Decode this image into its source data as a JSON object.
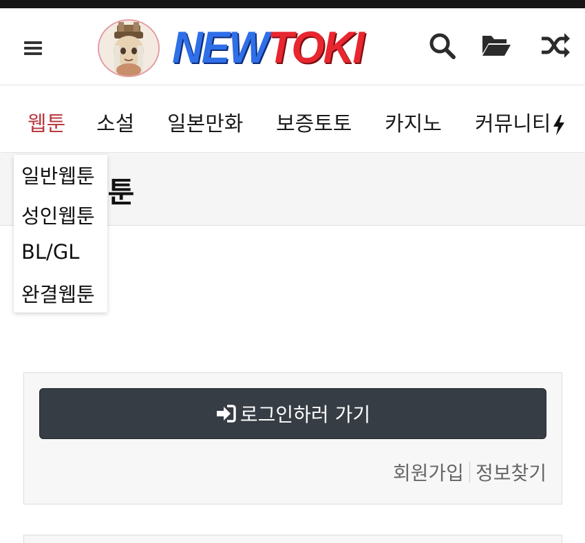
{
  "header": {
    "logo": {
      "part1": "NEW",
      "part2": "TOKI"
    },
    "icons": [
      "menu-icon",
      "search-icon",
      "folder-open-icon",
      "shuffle-icon"
    ]
  },
  "nav": {
    "items": [
      {
        "label": "웹툰",
        "active": true
      },
      {
        "label": "소설"
      },
      {
        "label": "일본만화"
      },
      {
        "label": "보증토토"
      },
      {
        "label": "카지노"
      },
      {
        "label": "커뮤니티"
      }
    ],
    "accent": "#b93a42"
  },
  "dropdown": {
    "items": [
      {
        "label": "일반웹툰"
      },
      {
        "label": "성인웹툰"
      },
      {
        "label": "BL/GL"
      },
      {
        "label": "완결웹툰"
      }
    ]
  },
  "page": {
    "title": "웹툰"
  },
  "login": {
    "button_label": "로그인하러 가기",
    "signup_link": "회원가입",
    "find_info_link": "정보찾기"
  }
}
